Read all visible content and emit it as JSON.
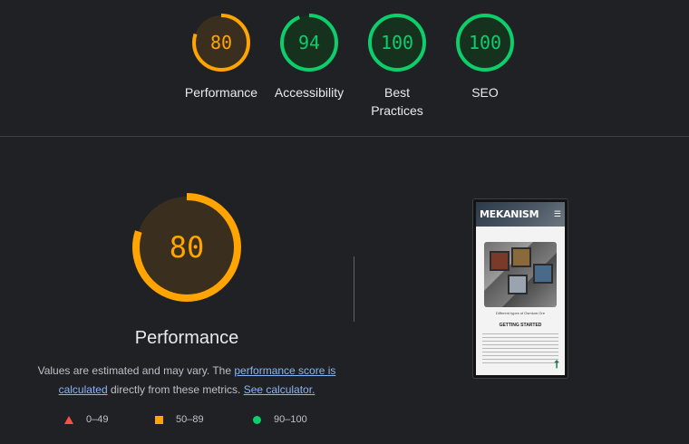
{
  "summary": [
    {
      "score": "80",
      "label": "Performance",
      "fraction": 0.8,
      "color": "#ffa400",
      "bg": "#3a2f1f"
    },
    {
      "score": "94",
      "label": "Accessibility",
      "fraction": 0.94,
      "color": "#0cce6b",
      "bg": "#16321f"
    },
    {
      "score": "100",
      "label": "Best Practices",
      "fraction": 1.0,
      "color": "#0cce6b",
      "bg": "#16321f"
    },
    {
      "score": "100",
      "label": "SEO",
      "fraction": 1.0,
      "color": "#0cce6b",
      "bg": "#16321f"
    }
  ],
  "category": {
    "score": "80",
    "fraction": 0.8,
    "title": "Performance",
    "desc_prefix": "Values are estimated and may vary. The ",
    "desc_link1": "performance score is calculated",
    "desc_mid": " directly from these metrics. ",
    "desc_link2": "See calculator."
  },
  "legend": [
    {
      "range": "0–49",
      "shape": "triangle",
      "color": "#ff4e42"
    },
    {
      "range": "50–89",
      "shape": "square",
      "color": "#ffa400"
    },
    {
      "range": "90–100",
      "shape": "circle",
      "color": "#0cce6b"
    }
  ],
  "screenshot": {
    "site_title": "MEKANISM",
    "menu_icon": "hamburger-icon",
    "caption": "Different types of Osmium Ore",
    "heading": "GETTING STARTED",
    "scroll_icon": "arrow-up-icon"
  }
}
